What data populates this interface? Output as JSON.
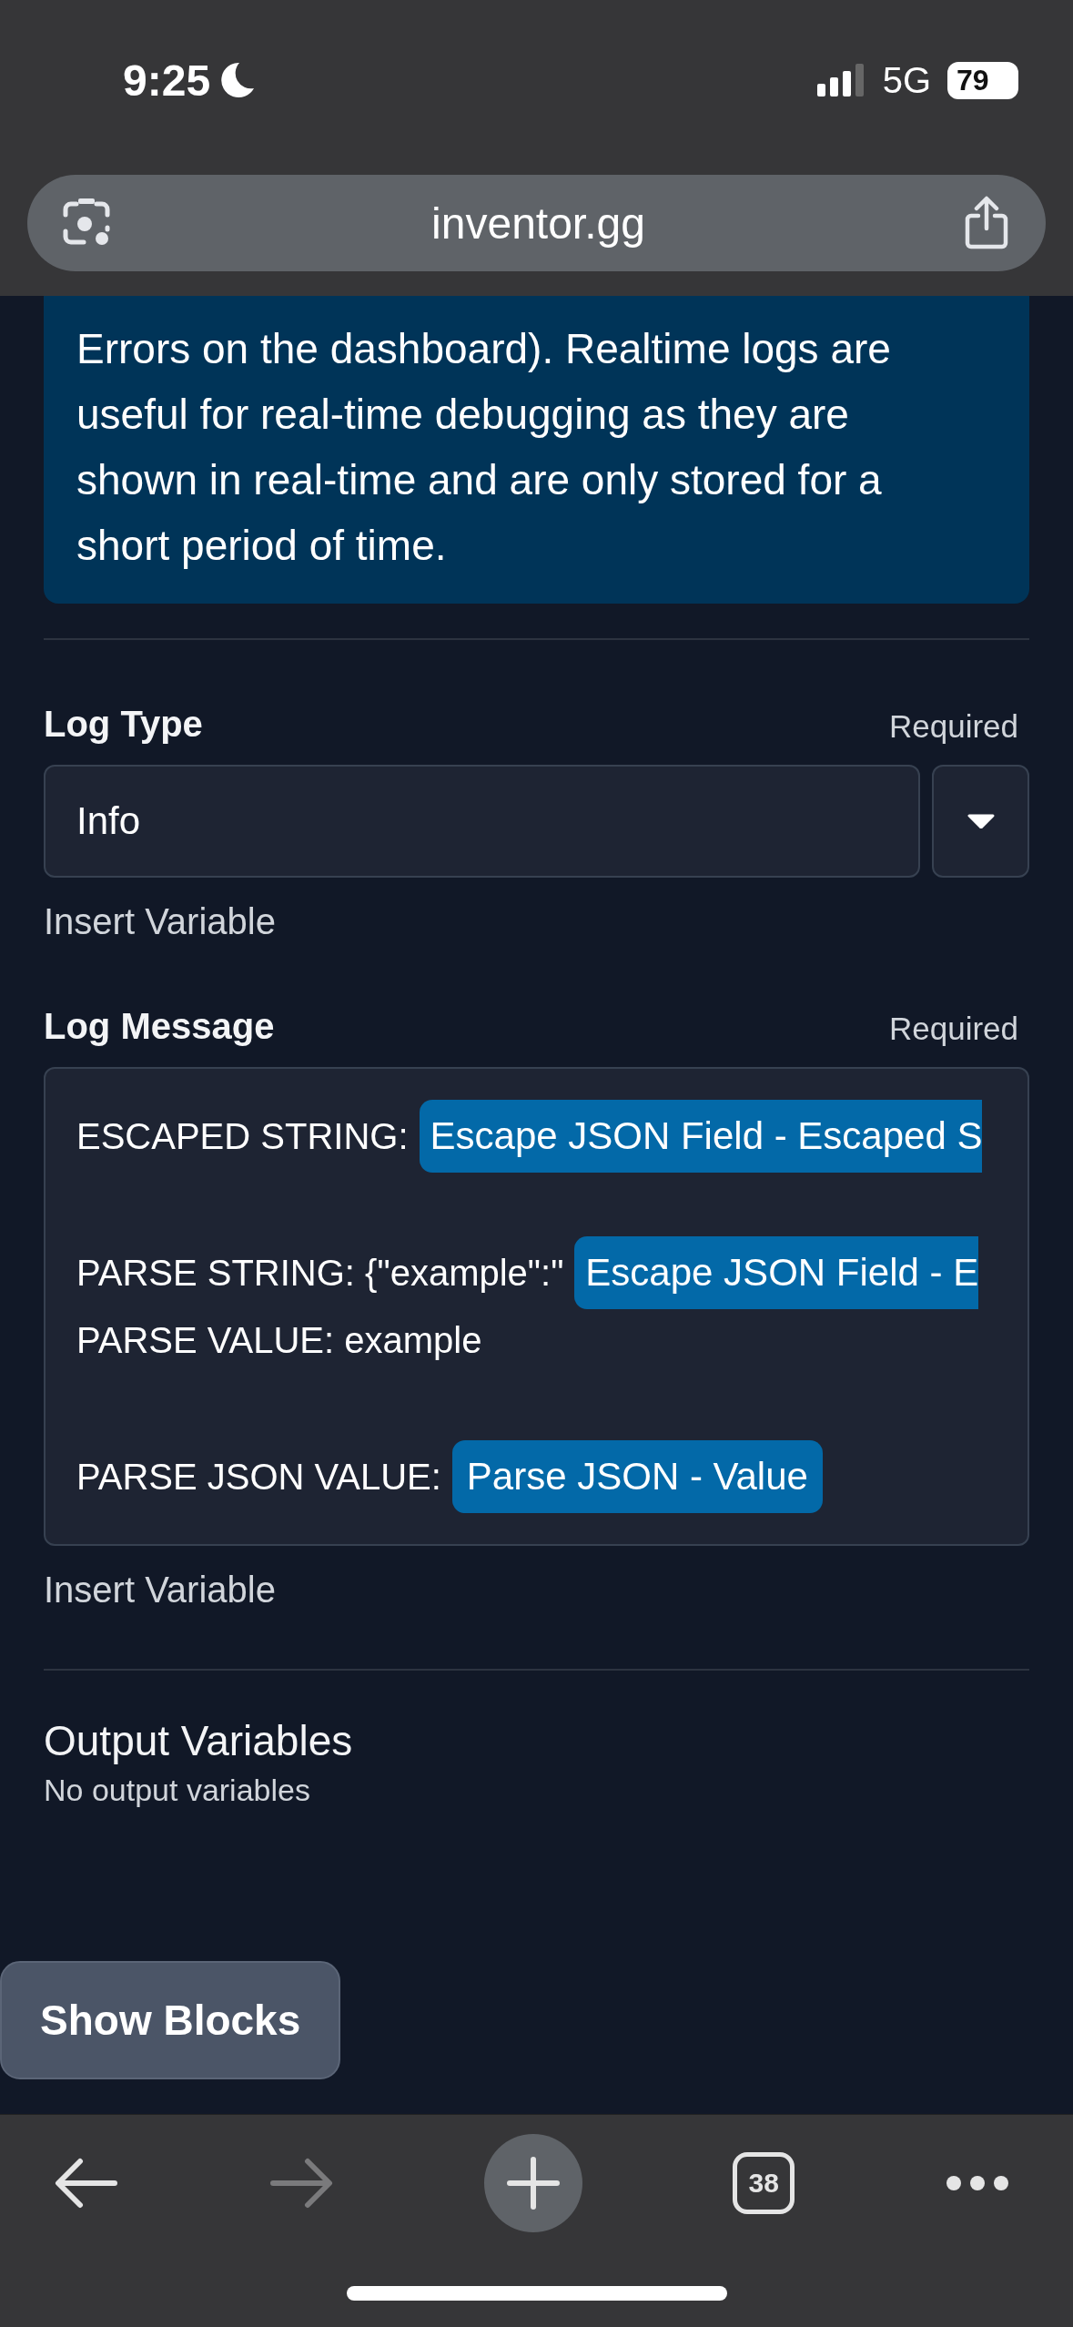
{
  "status_bar": {
    "time": "9:25",
    "network": "5G",
    "battery": "79"
  },
  "address_bar": {
    "url": "inventor.gg"
  },
  "info_box": {
    "text": "Errors on the dashboard). Realtime logs are useful for real-time debugging as they are shown in real-time and are only stored for a short period of time."
  },
  "log_type": {
    "label": "Log Type",
    "required": "Required",
    "value": "Info",
    "insert_variable": "Insert Variable"
  },
  "log_message": {
    "label": "Log Message",
    "required": "Required",
    "insert_variable": "Insert Variable",
    "lines": [
      {
        "spaced": false,
        "segments": [
          {
            "kind": "text",
            "text": "ESCAPED STRING:"
          },
          {
            "kind": "chip",
            "text": "Escape JSON Field - Escaped S"
          }
        ]
      },
      {
        "spaced": true,
        "segments": [
          {
            "kind": "text",
            "text": "PARSE STRING: {\"example\":\""
          },
          {
            "kind": "chip",
            "text": "Escape JSON Field - E"
          }
        ]
      },
      {
        "spaced": false,
        "segments": [
          {
            "kind": "text",
            "text": "PARSE VALUE: example"
          }
        ]
      },
      {
        "spaced": true,
        "segments": [
          {
            "kind": "text",
            "text": "PARSE JSON VALUE:"
          },
          {
            "kind": "chip",
            "text": "Parse JSON - Value"
          }
        ]
      }
    ]
  },
  "output_variables": {
    "title": "Output Variables",
    "empty_text": "No output variables"
  },
  "show_blocks_button": "Show Blocks",
  "toolbar": {
    "tabs_count": "38",
    "forward_disabled": true
  }
}
